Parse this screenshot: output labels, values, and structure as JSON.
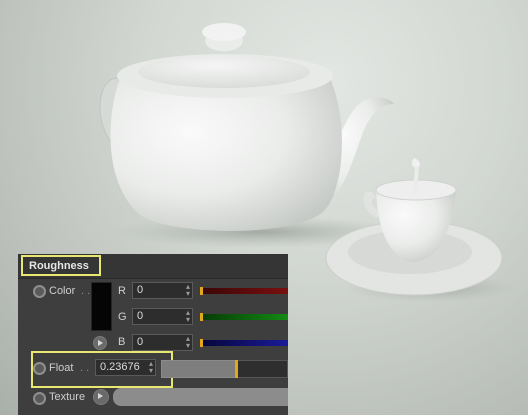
{
  "panel": {
    "title": "Roughness",
    "color": {
      "label": "Color",
      "dots": ". .",
      "swatch_color": "#050505",
      "channels": [
        {
          "label": "R",
          "value": "0",
          "track_color": "#7a1010"
        },
        {
          "label": "G",
          "value": "0",
          "track_color": "#138a13"
        },
        {
          "label": "B",
          "value": "0",
          "track_color": "#1a1a9a"
        }
      ]
    },
    "float": {
      "label": "Float",
      "dots": ". .",
      "value": "0.23676"
    },
    "texture": {
      "label": "Texture"
    },
    "accent_color": "#e8e870",
    "slider_knob_color": "#e2a818"
  }
}
